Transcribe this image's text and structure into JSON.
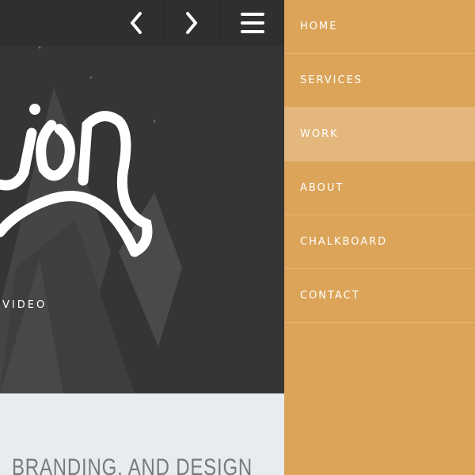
{
  "topbar": {
    "prev_icon": "chevron-left-icon",
    "next_icon": "chevron-right-icon",
    "menu_icon": "hamburger-icon"
  },
  "hero": {
    "logo_text": "ion",
    "subtitle": "VIDEO"
  },
  "section": {
    "heading": "BRANDING, AND DESIGN"
  },
  "menu": {
    "active": "WORK",
    "items": [
      {
        "label": "HOME"
      },
      {
        "label": "SERVICES"
      },
      {
        "label": "WORK"
      },
      {
        "label": "ABOUT"
      },
      {
        "label": "CHALKBOARD"
      },
      {
        "label": "CONTACT"
      }
    ]
  },
  "colors": {
    "menu_bg": "#dba458",
    "menu_active": "#e4b87c",
    "topbar": "#2f2f2f",
    "hero": "#353535",
    "section": "#e6ecef"
  }
}
